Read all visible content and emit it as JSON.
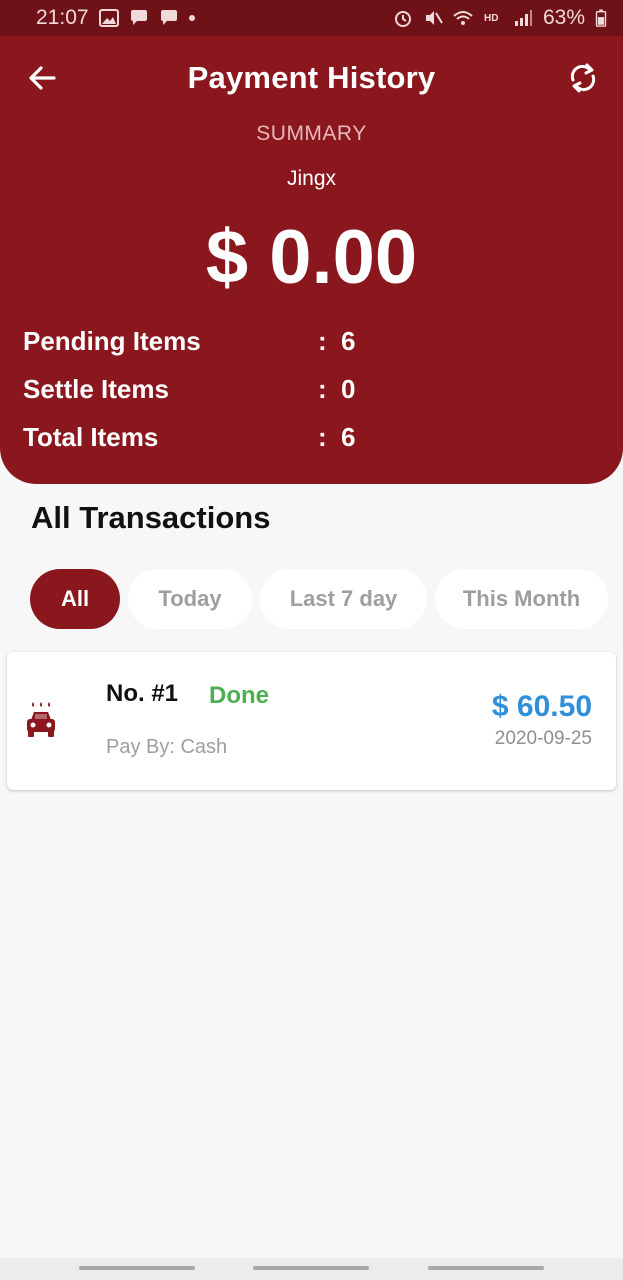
{
  "status_bar": {
    "time": "21:07",
    "battery": "63%",
    "left_icons": [
      "image-icon",
      "chat-icon",
      "chat-icon",
      "dot-icon"
    ],
    "right_icons": [
      "alarm-icon",
      "mute-icon",
      "wifi-icon",
      "hd-icon",
      "signal-icon",
      "battery-icon"
    ],
    "background": "#6f1217"
  },
  "header": {
    "title": "Payment History",
    "back_icon": "arrow-left-icon",
    "refresh_icon": "refresh-icon",
    "summary_label": "SUMMARY",
    "user_name": "Jingx",
    "amount": "$ 0.00",
    "background": "#8a171d",
    "stats": [
      {
        "label": "Pending Items",
        "colon": ":",
        "value": "6"
      },
      {
        "label": "Settle Items",
        "colon": ":",
        "value": "0"
      },
      {
        "label": "Total Items",
        "colon": ":",
        "value": "6"
      }
    ]
  },
  "transactions": {
    "title": "All Transactions",
    "filters": [
      {
        "label": "All",
        "active": true
      },
      {
        "label": "Today",
        "active": false
      },
      {
        "label": "Last 7 day",
        "active": false
      },
      {
        "label": "This Month",
        "active": false
      }
    ],
    "items": [
      {
        "icon": "car-wash-icon",
        "number": "No. #1",
        "status": "Done",
        "pay_by": "Pay By: Cash",
        "amount": "$ 60.50",
        "date": "2020-09-25",
        "status_color": "#4caf50",
        "amount_color": "#2f8fd8"
      }
    ]
  }
}
